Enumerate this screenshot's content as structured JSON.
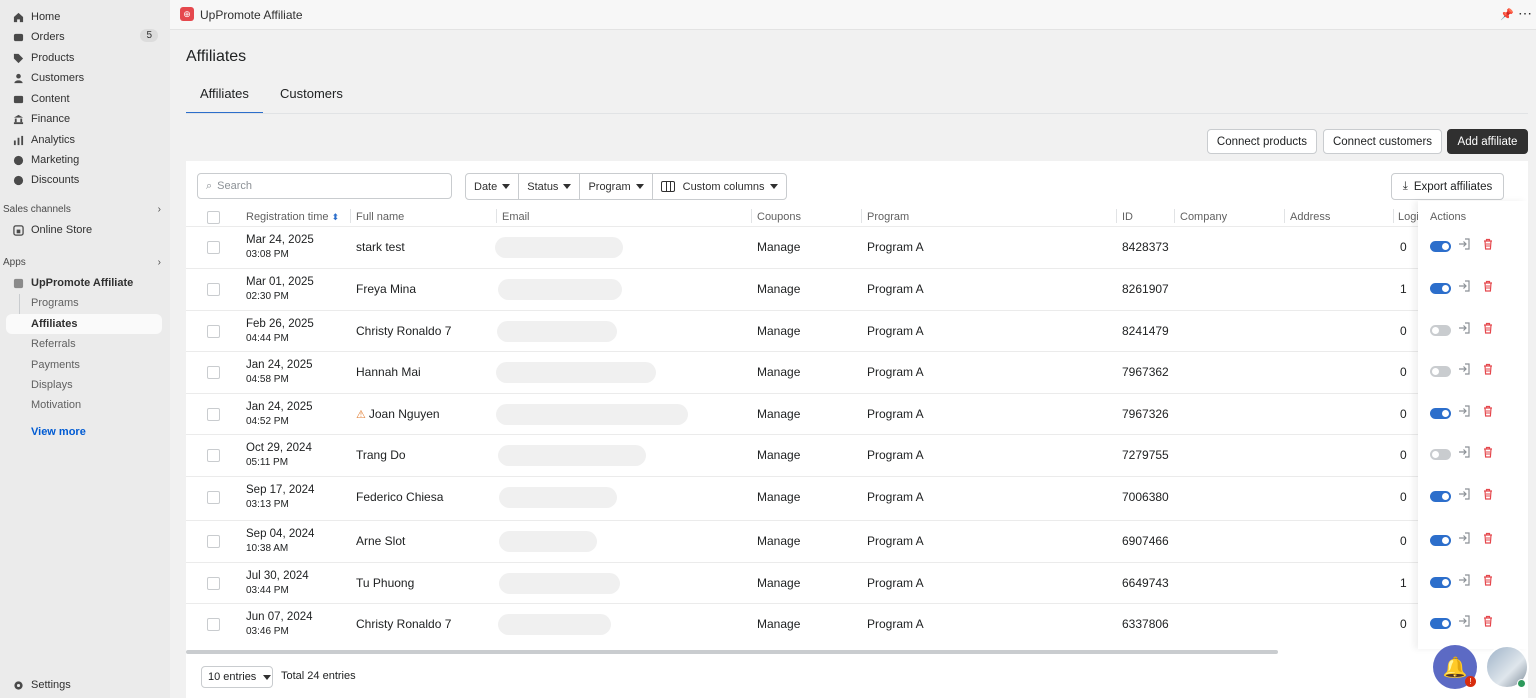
{
  "sidebar": {
    "items": [
      {
        "label": "Home",
        "icon": "home-icon"
      },
      {
        "label": "Orders",
        "icon": "orders-icon",
        "badge": "5"
      },
      {
        "label": "Products",
        "icon": "tag-icon"
      },
      {
        "label": "Customers",
        "icon": "person-icon"
      },
      {
        "label": "Content",
        "icon": "content-icon"
      },
      {
        "label": "Finance",
        "icon": "bank-icon"
      },
      {
        "label": "Analytics",
        "icon": "chart-icon"
      },
      {
        "label": "Marketing",
        "icon": "target-icon"
      },
      {
        "label": "Discounts",
        "icon": "discount-icon"
      }
    ],
    "sales_channels_label": "Sales channels",
    "online_store": "Online Store",
    "apps_label": "Apps",
    "app_name": "UpPromote Affiliate",
    "sub_items": [
      "Programs",
      "Affiliates",
      "Referrals",
      "Payments",
      "Displays",
      "Motivation"
    ],
    "view_more": "View more",
    "settings": "Settings"
  },
  "topbar": {
    "app_name": "UpPromote Affiliate"
  },
  "page": {
    "title": "Affiliates",
    "tabs": [
      "Affiliates",
      "Customers"
    ]
  },
  "buttons": {
    "connect_products": "Connect products",
    "connect_customers": "Connect customers",
    "add_affiliate": "Add affiliate",
    "export": "Export affiliates"
  },
  "search": {
    "placeholder": "Search"
  },
  "filters": [
    "Date",
    "Status",
    "Program",
    "Custom columns"
  ],
  "columns": [
    "Registration time",
    "Full name",
    "Email",
    "Coupons",
    "Program",
    "ID",
    "Company",
    "Address",
    "Logi",
    "Actions"
  ],
  "rows": [
    {
      "date": "Mar 24, 2025",
      "time": "03:08 PM",
      "name": "stark test",
      "coupons": "Manage",
      "program": "Program A",
      "id": "8428373",
      "logins": "0",
      "active": true,
      "warn": false
    },
    {
      "date": "Mar 01, 2025",
      "time": "02:30 PM",
      "name": "Freya Mina",
      "coupons": "Manage",
      "program": "Program A",
      "id": "8261907",
      "logins": "1",
      "active": true,
      "warn": false
    },
    {
      "date": "Feb 26, 2025",
      "time": "04:44 PM",
      "name": "Christy Ronaldo 7",
      "coupons": "Manage",
      "program": "Program A",
      "id": "8241479",
      "logins": "0",
      "active": false,
      "warn": false
    },
    {
      "date": "Jan 24, 2025",
      "time": "04:58 PM",
      "name": "Hannah Mai",
      "coupons": "Manage",
      "program": "Program A",
      "id": "7967362",
      "logins": "0",
      "active": false,
      "warn": false
    },
    {
      "date": "Jan 24, 2025",
      "time": "04:52 PM",
      "name": "Joan Nguyen",
      "coupons": "Manage",
      "program": "Program A",
      "id": "7967326",
      "logins": "0",
      "active": true,
      "warn": true
    },
    {
      "date": "Oct 29, 2024",
      "time": "05:11 PM",
      "name": "Trang Do",
      "coupons": "Manage",
      "program": "Program A",
      "id": "7279755",
      "logins": "0",
      "active": false,
      "warn": false
    },
    {
      "date": "Sep 17, 2024",
      "time": "03:13 PM",
      "name": "Federico Chiesa",
      "coupons": "Manage",
      "program": "Program A",
      "id": "7006380",
      "logins": "0",
      "active": true,
      "warn": false
    },
    {
      "date": "Sep 04, 2024",
      "time": "10:38 AM",
      "name": "Arne Slot",
      "coupons": "Manage",
      "program": "Program A",
      "id": "6907466",
      "logins": "0",
      "active": true,
      "warn": false
    },
    {
      "date": "Jul 30, 2024",
      "time": "03:44 PM",
      "name": "Tu Phuong",
      "coupons": "Manage",
      "program": "Program A",
      "id": "6649743",
      "logins": "1",
      "active": true,
      "warn": false
    },
    {
      "date": "Jun 07, 2024",
      "time": "03:46 PM",
      "name": "Christy Ronaldo 7",
      "coupons": "Manage",
      "program": "Program A",
      "id": "6337806",
      "logins": "0",
      "active": true,
      "warn": false
    }
  ],
  "footer": {
    "per_page": "10 entries",
    "total": "Total 24 entries"
  },
  "notifications": {
    "badge": "!"
  }
}
